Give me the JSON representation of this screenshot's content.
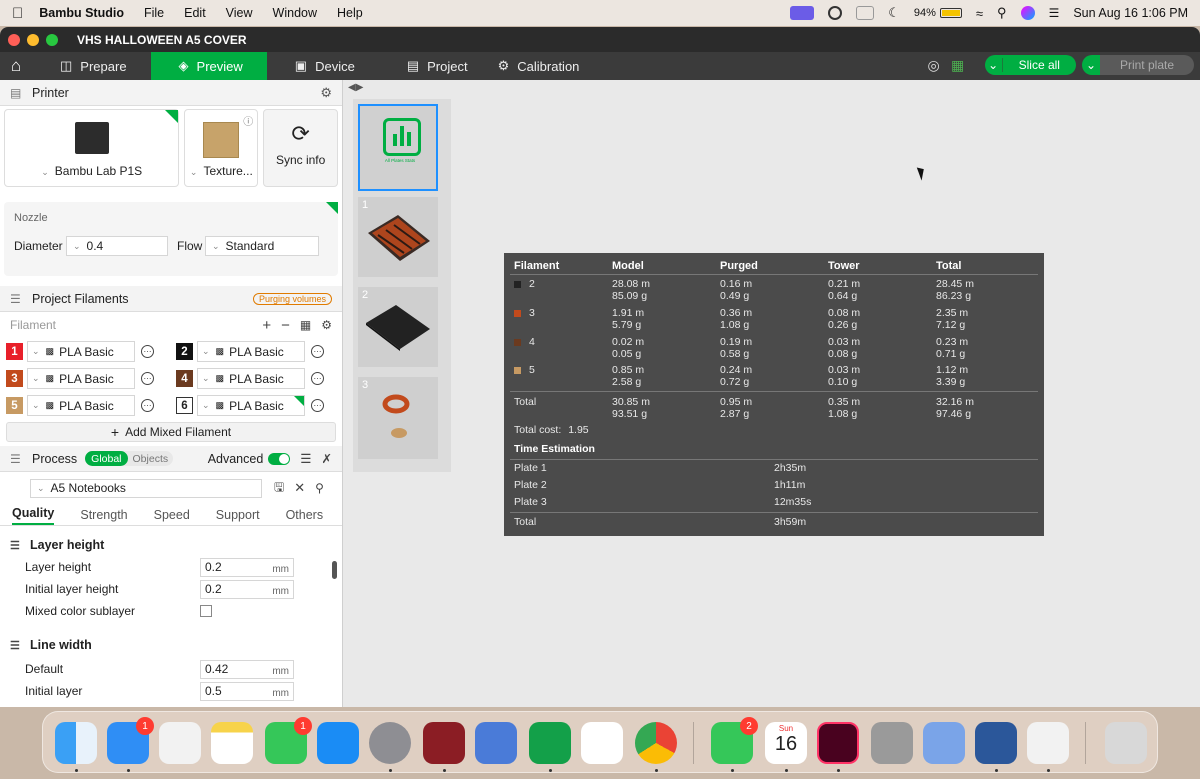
{
  "menubar": {
    "app_name": "Bambu Studio",
    "menus": [
      "File",
      "Edit",
      "View",
      "Window",
      "Help"
    ],
    "battery": "94%",
    "datetime": "Sun Aug 16  1:06 PM"
  },
  "window": {
    "title": "VHS HALLOWEEN A5 COVER"
  },
  "toolbar": {
    "tabs": [
      {
        "label": "Prepare"
      },
      {
        "label": "Preview"
      },
      {
        "label": "Device"
      },
      {
        "label": "Project"
      },
      {
        "label": "Calibration"
      }
    ],
    "slice_label": "Slice all",
    "print_label": "Print plate"
  },
  "printer": {
    "section_title": "Printer",
    "printer_name": "Bambu Lab P1S",
    "plate_name": "Texture...",
    "sync_label": "Sync info",
    "nozzle_label": "Nozzle",
    "diameter_label": "Diameter",
    "diameter_value": "0.4",
    "flow_label": "Flow",
    "flow_value": "Standard"
  },
  "filaments": {
    "section_title": "Project Filaments",
    "purging_label": "Purging volumes",
    "list_label": "Filament",
    "items": [
      {
        "num": "1",
        "color": "#e8202a",
        "name": "PLA Basic"
      },
      {
        "num": "2",
        "color": "#111111",
        "name": "PLA Basic"
      },
      {
        "num": "3",
        "color": "#c24a1c",
        "name": "PLA Basic"
      },
      {
        "num": "4",
        "color": "#6b3a1f",
        "name": "PLA Basic"
      },
      {
        "num": "5",
        "color": "#c79a63",
        "name": "PLA Basic"
      },
      {
        "num": "6",
        "color": "#ffffff",
        "name": "PLA Basic"
      }
    ],
    "add_mixed_label": "Add Mixed Filament"
  },
  "process": {
    "section_title": "Process",
    "global_label": "Global",
    "objects_label": "Objects",
    "advanced_label": "Advanced",
    "preset_name": "A5 Notebooks",
    "subtabs": [
      "Quality",
      "Strength",
      "Speed",
      "Support",
      "Others"
    ],
    "groups": [
      {
        "title": "Layer height",
        "rows": [
          {
            "label": "Layer height",
            "value": "0.2",
            "unit": "mm"
          },
          {
            "label": "Initial layer height",
            "value": "0.2",
            "unit": "mm"
          },
          {
            "label": "Mixed color sublayer"
          }
        ]
      },
      {
        "title": "Line width",
        "rows": [
          {
            "label": "Default",
            "value": "0.42",
            "unit": "mm"
          },
          {
            "label": "Initial layer",
            "value": "0.5",
            "unit": "mm"
          }
        ]
      }
    ]
  },
  "plates": {
    "all_stats_label": "All Plates Stats",
    "items": [
      "1",
      "2",
      "3"
    ]
  },
  "stats": {
    "headers": [
      "Filament",
      "Model",
      "Purged",
      "Tower",
      "Total"
    ],
    "rows": [
      {
        "id": "2",
        "color": "#222222",
        "model": [
          "28.08 m",
          "85.09 g"
        ],
        "purged": [
          "0.16 m",
          "0.49 g"
        ],
        "tower": [
          "0.21 m",
          "0.64 g"
        ],
        "total": [
          "28.45 m",
          "86.23 g"
        ]
      },
      {
        "id": "3",
        "color": "#c24a1c",
        "model": [
          "1.91 m",
          "5.79 g"
        ],
        "purged": [
          "0.36 m",
          "1.08 g"
        ],
        "tower": [
          "0.08 m",
          "0.26 g"
        ],
        "total": [
          "2.35 m",
          "7.12 g"
        ]
      },
      {
        "id": "4",
        "color": "#6b3a1f",
        "model": [
          "0.02 m",
          "0.05 g"
        ],
        "purged": [
          "0.19 m",
          "0.58 g"
        ],
        "tower": [
          "0.03 m",
          "0.08 g"
        ],
        "total": [
          "0.23 m",
          "0.71 g"
        ]
      },
      {
        "id": "5",
        "color": "#c79a63",
        "model": [
          "0.85 m",
          "2.58 g"
        ],
        "purged": [
          "0.24 m",
          "0.72 g"
        ],
        "tower": [
          "0.03 m",
          "0.10 g"
        ],
        "total": [
          "1.12 m",
          "3.39 g"
        ]
      }
    ],
    "total": {
      "label": "Total",
      "model": [
        "30.85 m",
        "93.51 g"
      ],
      "purged": [
        "0.95 m",
        "2.87 g"
      ],
      "tower": [
        "0.35 m",
        "1.08 g"
      ],
      "total": [
        "32.16 m",
        "97.46 g"
      ]
    },
    "total_cost_label": "Total cost:",
    "total_cost_value": "1.95",
    "time_title": "Time Estimation",
    "times": [
      {
        "label": "Plate 1",
        "value": "2h35m"
      },
      {
        "label": "Plate 2",
        "value": "1h11m"
      },
      {
        "label": "Plate 3",
        "value": "12m35s"
      }
    ],
    "time_total": {
      "label": "Total",
      "value": "3h59m"
    }
  },
  "dock": {
    "mail_badge": "1",
    "facetime_badge": "1",
    "messages_badge": "2",
    "calendar_month": "Sun",
    "calendar_day": "16"
  }
}
